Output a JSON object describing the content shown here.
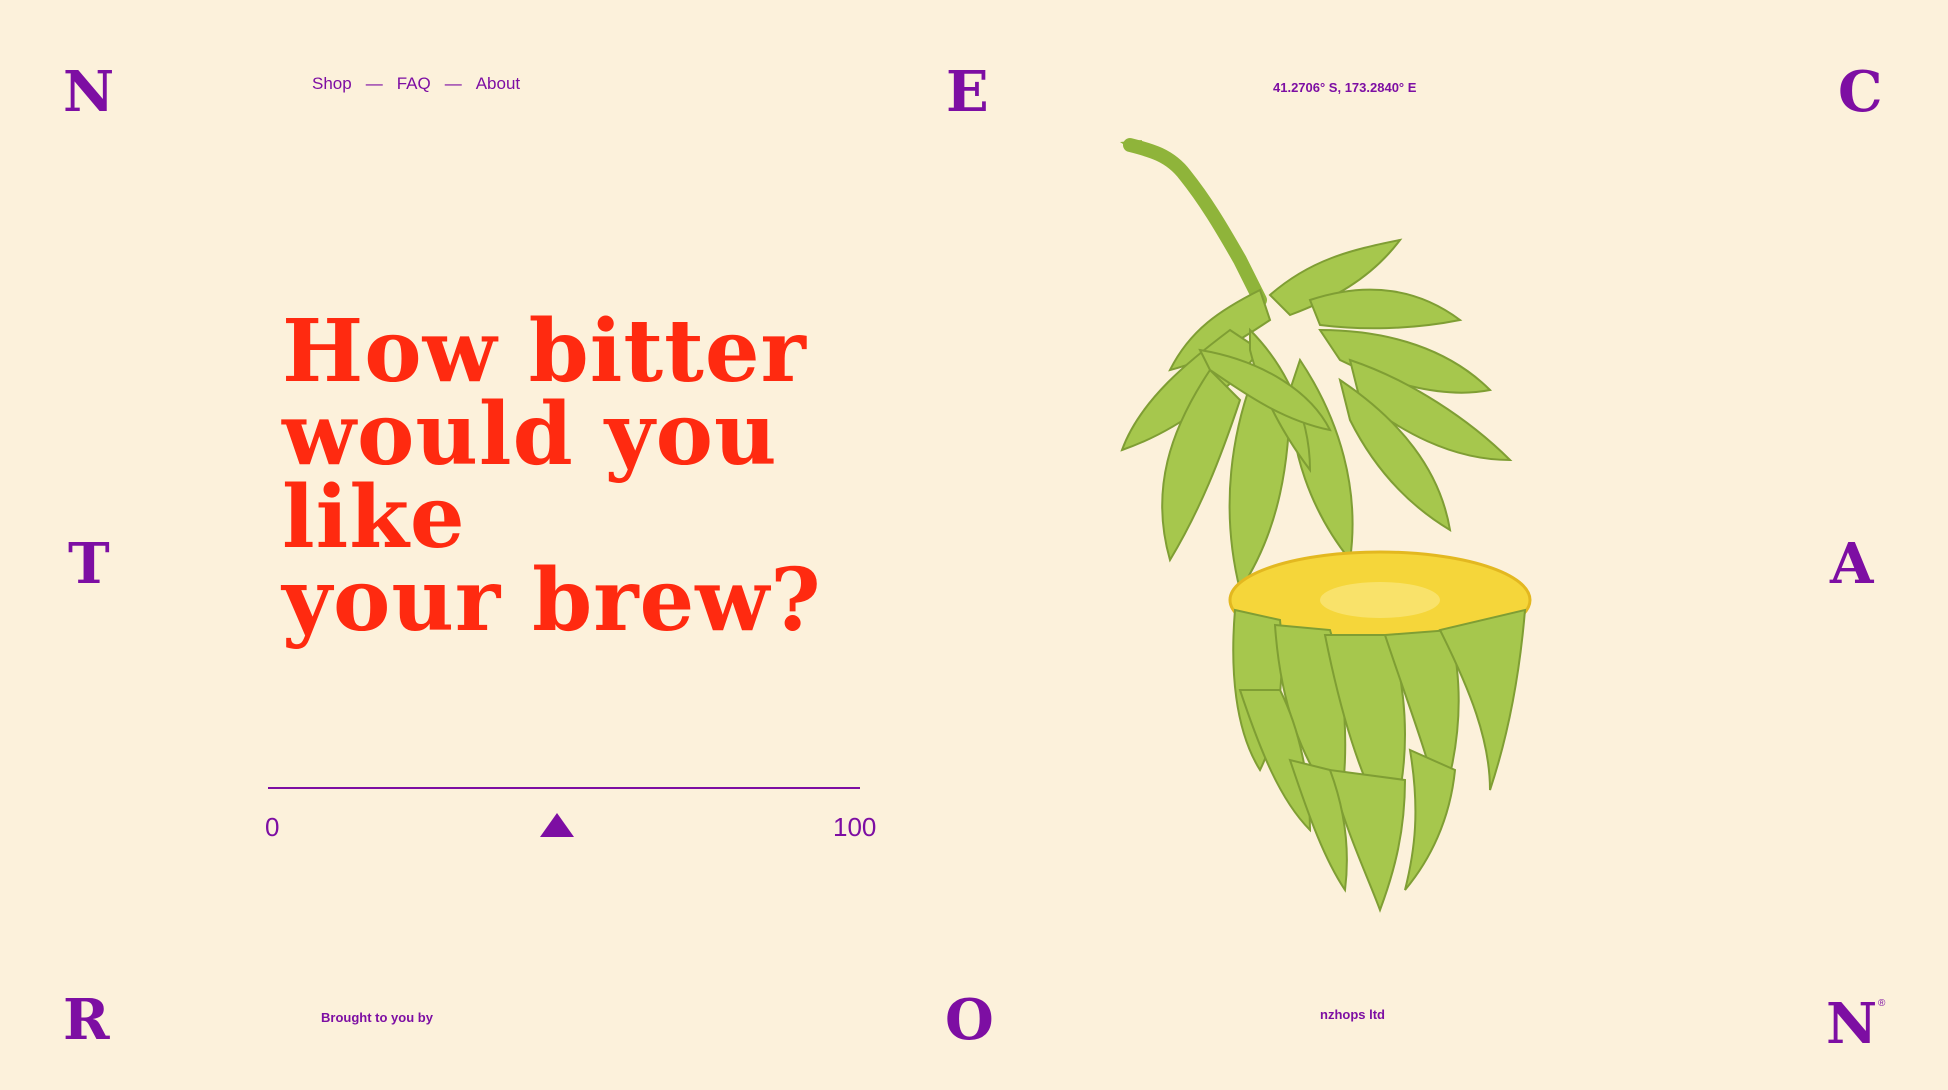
{
  "nav": {
    "shop": "Shop",
    "faq": "FAQ",
    "about": "About",
    "separator": "—"
  },
  "coordinates": "41.2706° S, 173.2840° E",
  "headline": {
    "line1": "How bitter",
    "line2": "would you like",
    "line3": "your brew?"
  },
  "slider": {
    "min_label": "0",
    "max_label": "100",
    "value": 50
  },
  "footer": {
    "brought": "Brought to you by",
    "company": "nzhops ltd"
  },
  "border_letters": {
    "top_left": "N",
    "top_center": "E",
    "top_right": "C",
    "mid_left": "T",
    "mid_right": "A",
    "bottom_left": "R",
    "bottom_center": "O",
    "bottom_right": "N"
  },
  "registered_mark": "®",
  "colors": {
    "background": "#fcf1db",
    "accent": "#7d0ea3",
    "headline": "#ff2a10",
    "hop_green": "#a8c850",
    "hop_core": "#f5d63a"
  },
  "image": {
    "icon": "hop-cone-illustration"
  }
}
